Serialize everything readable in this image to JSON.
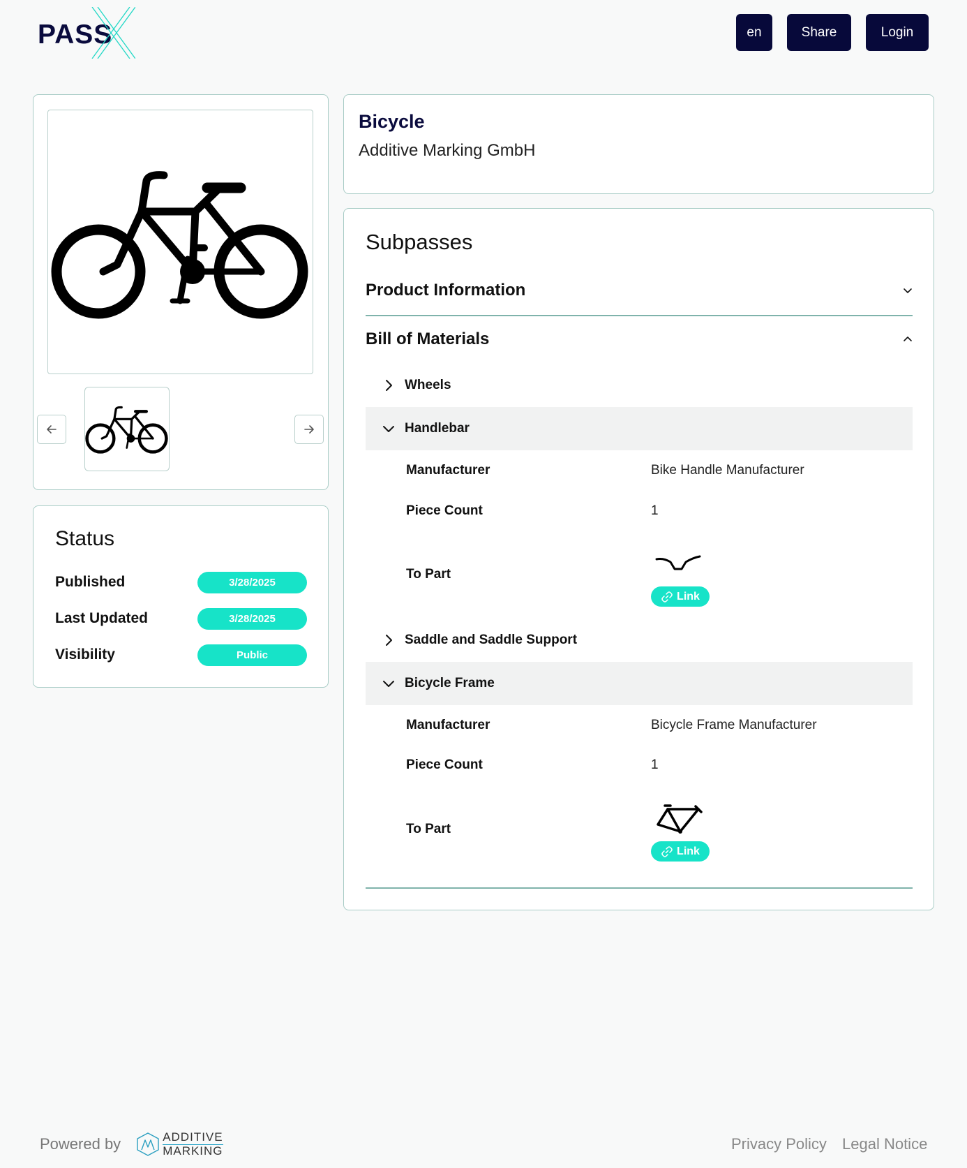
{
  "header": {
    "logo_text": "PASS",
    "lang_label": "en",
    "share_label": "Share",
    "login_label": "Login"
  },
  "product": {
    "name": "Bicycle",
    "company": "Additive Marking GmbH"
  },
  "status": {
    "title": "Status",
    "rows": [
      {
        "label": "Published",
        "value": "3/28/2025"
      },
      {
        "label": "Last Updated",
        "value": "3/28/2025"
      },
      {
        "label": "Visibility",
        "value": "Public"
      }
    ]
  },
  "subpasses": {
    "title": "Subpasses",
    "sections": [
      {
        "label": "Product Information",
        "expanded": false
      },
      {
        "label": "Bill of Materials",
        "expanded": true
      }
    ],
    "bom": {
      "nodes": [
        {
          "label": "Wheels",
          "expanded": false
        },
        {
          "label": "Handlebar",
          "expanded": true,
          "manufacturer_label": "Manufacturer",
          "manufacturer": "Bike Handle Manufacturer",
          "piece_count_label": "Piece Count",
          "piece_count": "1",
          "to_part_label": "To Part",
          "link_label": "Link"
        },
        {
          "label": "Saddle and Saddle Support",
          "expanded": false
        },
        {
          "label": "Bicycle Frame",
          "expanded": true,
          "manufacturer_label": "Manufacturer",
          "manufacturer": "Bicycle Frame Manufacturer",
          "piece_count_label": "Piece Count",
          "piece_count": "1",
          "to_part_label": "To Part",
          "link_label": "Link"
        }
      ]
    }
  },
  "footer": {
    "powered_by": "Powered by",
    "brand_line1": "ADDITIVE",
    "brand_line2": "MARKING",
    "privacy": "Privacy Policy",
    "legal": "Legal Notice"
  },
  "colors": {
    "primary_dark": "#07093a",
    "accent": "#17e3c8",
    "card_border": "#a8ccc6"
  }
}
